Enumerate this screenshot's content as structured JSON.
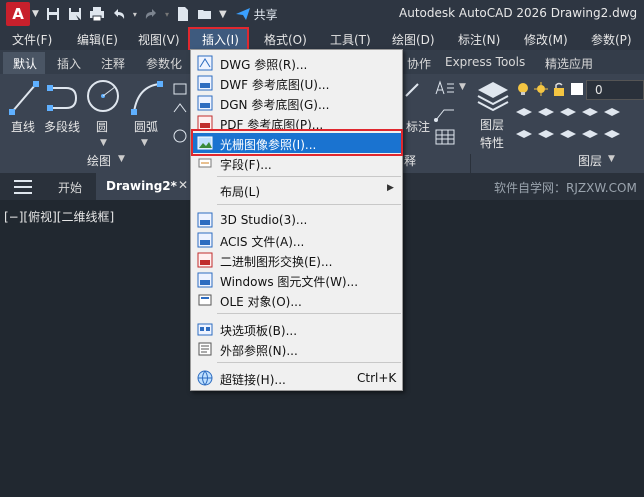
{
  "titlebar": {
    "logo": "A",
    "share_label": "共享",
    "title": "Autodesk AutoCAD 2026    Drawing2.dwg",
    "icons": [
      "save-icon",
      "save-as-icon",
      "print-icon",
      "undo-icon",
      "redo-icon",
      "new-icon",
      "open-icon",
      "dropdown-icon",
      "share-icon"
    ]
  },
  "menubar": {
    "items": [
      "文件(F)",
      "编辑(E)",
      "视图(V)",
      "插入(I)",
      "格式(O)",
      "工具(T)",
      "绘图(D)",
      "标注(N)",
      "修改(M)",
      "参数(P)"
    ],
    "active": "插入(I)"
  },
  "ribbon_tabs": {
    "items": [
      "默认",
      "插入",
      "注释",
      "参数化",
      "协作",
      "Express Tools",
      "精选应用"
    ],
    "active": "默认"
  },
  "ribbon": {
    "tools": [
      "直线",
      "多段线",
      "圆",
      "圆弧",
      "标注",
      "图层特性"
    ],
    "panels": [
      "绘图",
      "图层"
    ],
    "layer_value": "0",
    "partial_text": "释"
  },
  "filetabs": {
    "menu_icon": "hamburger-icon",
    "start": "开始",
    "active": "Drawing2*",
    "watermark": "软件自学网：RJZXW.COM"
  },
  "viewport": {
    "label": "[−][俯视][二维线框]"
  },
  "dropdown": {
    "items": [
      {
        "label": "DWG 参照(R)...",
        "shortcut": "",
        "icon": "dwg-icon"
      },
      {
        "label": "DWF 参考底图(U)...",
        "shortcut": "",
        "icon": "dwf-icon"
      },
      {
        "label": "DGN 参考底图(G)...",
        "shortcut": "",
        "icon": "dgn-icon"
      },
      {
        "label": "PDF 参考底图(P)...",
        "shortcut": "",
        "icon": "pdf-icon"
      },
      {
        "label": "光栅图像参照(I)...",
        "shortcut": "",
        "icon": "raster-image-icon",
        "highlighted": true
      },
      {
        "label": "字段(F)...",
        "shortcut": "",
        "icon": "field-icon"
      },
      {
        "label": "布局(L)",
        "shortcut": "",
        "icon": "",
        "submenu": true
      },
      {
        "label": "3D Studio(3)...",
        "shortcut": "",
        "icon": "3ds-icon"
      },
      {
        "label": "ACIS 文件(A)...",
        "shortcut": "",
        "icon": "acis-icon"
      },
      {
        "label": "二进制图形交换(E)...",
        "shortcut": "",
        "icon": "dxb-icon"
      },
      {
        "label": "Windows 图元文件(W)...",
        "shortcut": "",
        "icon": "wmf-icon"
      },
      {
        "label": "OLE 对象(O)...",
        "shortcut": "",
        "icon": "ole-icon"
      },
      {
        "label": "块选项板(B)...",
        "shortcut": "",
        "icon": "block-palette-icon"
      },
      {
        "label": "外部参照(N)...",
        "shortcut": "",
        "icon": "xref-icon"
      },
      {
        "label": "超链接(H)...",
        "shortcut": "Ctrl+K",
        "icon": "hyperlink-icon"
      }
    ]
  },
  "colors": {
    "highlight": "#1a73d0",
    "red_frame": "#e0282f",
    "background": "#212830"
  }
}
